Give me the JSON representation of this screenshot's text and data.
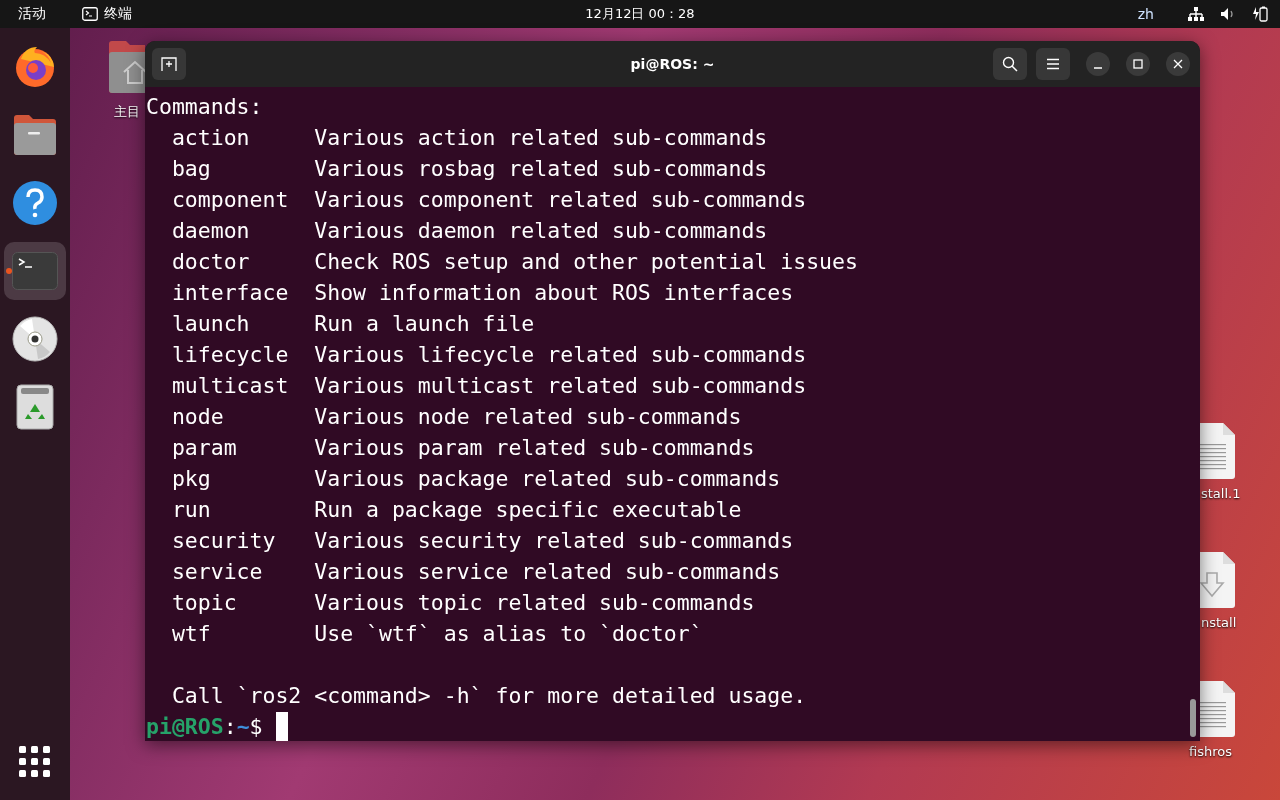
{
  "top_bar": {
    "activities": "活动",
    "app_name": "终端",
    "clock": "12月12日 00：28",
    "input_method": "zh"
  },
  "dock": {
    "items": [
      {
        "kind": "firefox",
        "active": false,
        "running": false
      },
      {
        "kind": "files",
        "active": false,
        "running": false
      },
      {
        "kind": "help",
        "active": false,
        "running": false
      },
      {
        "kind": "terminal",
        "active": true,
        "running": true
      },
      {
        "kind": "disc",
        "active": false,
        "running": false
      },
      {
        "kind": "trash",
        "active": false,
        "running": false
      }
    ]
  },
  "desktop_icons": [
    {
      "kind": "home",
      "label": "主目"
    },
    {
      "kind": "text",
      "label": "stall.1"
    },
    {
      "kind": "download",
      "label": "nstall"
    },
    {
      "kind": "text",
      "label": "fishros"
    }
  ],
  "terminal": {
    "title": "pi@ROS: ~",
    "heading": "Commands:",
    "commands": [
      {
        "name": "action",
        "description": "Various action related sub-commands"
      },
      {
        "name": "bag",
        "description": "Various rosbag related sub-commands"
      },
      {
        "name": "component",
        "description": "Various component related sub-commands"
      },
      {
        "name": "daemon",
        "description": "Various daemon related sub-commands"
      },
      {
        "name": "doctor",
        "description": "Check ROS setup and other potential issues"
      },
      {
        "name": "interface",
        "description": "Show information about ROS interfaces"
      },
      {
        "name": "launch",
        "description": "Run a launch file"
      },
      {
        "name": "lifecycle",
        "description": "Various lifecycle related sub-commands"
      },
      {
        "name": "multicast",
        "description": "Various multicast related sub-commands"
      },
      {
        "name": "node",
        "description": "Various node related sub-commands"
      },
      {
        "name": "param",
        "description": "Various param related sub-commands"
      },
      {
        "name": "pkg",
        "description": "Various package related sub-commands"
      },
      {
        "name": "run",
        "description": "Run a package specific executable"
      },
      {
        "name": "security",
        "description": "Various security related sub-commands"
      },
      {
        "name": "service",
        "description": "Various service related sub-commands"
      },
      {
        "name": "topic",
        "description": "Various topic related sub-commands"
      },
      {
        "name": "wtf",
        "description": "Use `wtf` as alias to `doctor`"
      }
    ],
    "footer": "Call `ros2 <command> -h` for more detailed usage.",
    "prompt": {
      "user_host": "pi@ROS",
      "separator": ":",
      "path": "~",
      "symbol": "$"
    }
  }
}
